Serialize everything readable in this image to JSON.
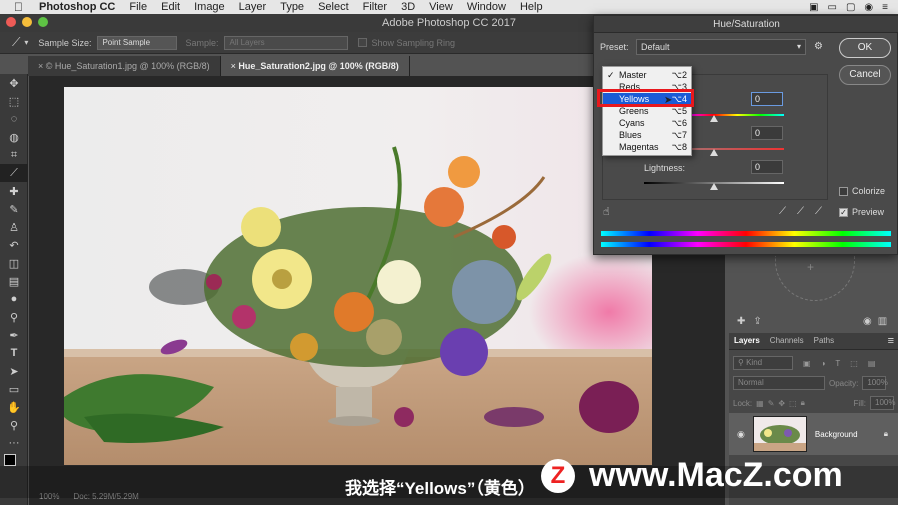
{
  "menubar": {
    "apple": "",
    "app_name": "Photoshop CC",
    "items": [
      "File",
      "Edit",
      "Image",
      "Layer",
      "Type",
      "Select",
      "Filter",
      "3D",
      "View",
      "Window",
      "Help"
    ]
  },
  "window": {
    "title": "Adobe Photoshop CC 2017"
  },
  "options_bar": {
    "sample_size_label": "Sample Size:",
    "sample_size_value": "Point Sample",
    "sample_label": "Sample:",
    "sample_value": "All Layers",
    "show_ring_label": "Show Sampling Ring"
  },
  "tabs": [
    {
      "label": "© Hue_Saturation1.jpg @ 100% (RGB/8)",
      "active": false
    },
    {
      "label": "Hue_Saturation2.jpg @ 100% (RGB/8)",
      "active": true
    }
  ],
  "status": {
    "zoom": "100%",
    "doc": "Doc: 5.29M/5.29M"
  },
  "dialog": {
    "title": "Hue/Saturation",
    "preset_label": "Preset:",
    "preset_value": "Default",
    "ok_label": "OK",
    "cancel_label": "Cancel",
    "hue_value": "0",
    "saturation_value": "0",
    "lightness_label": "Lightness:",
    "lightness_value": "0",
    "colorize_label": "Colorize",
    "preview_label": "Preview",
    "preview_checked": true,
    "colorize_checked": false
  },
  "channel_dropdown": {
    "items": [
      {
        "label": "Master",
        "key": "⌥2",
        "checked": true
      },
      {
        "label": "Reds",
        "key": "⌥3",
        "checked": false
      },
      {
        "label": "Yellows",
        "key": "⌥4",
        "checked": false,
        "highlight": true
      },
      {
        "label": "Greens",
        "key": "⌥5",
        "checked": false
      },
      {
        "label": "Cyans",
        "key": "⌥6",
        "checked": false
      },
      {
        "label": "Blues",
        "key": "⌥7",
        "checked": false
      },
      {
        "label": "Magentas",
        "key": "⌥8",
        "checked": false
      }
    ]
  },
  "layers_panel": {
    "tabs": [
      "Layers",
      "Channels",
      "Paths"
    ],
    "kind_label": "Kind",
    "blend_mode": "Normal",
    "opacity_label": "Opacity:",
    "opacity_value": "100%",
    "lock_label": "Lock:",
    "fill_label": "Fill:",
    "fill_value": "100%",
    "layer_name": "Background"
  },
  "subtitle": {
    "text": "我选择“Yellows”（黄色）"
  },
  "watermark": {
    "logo": "Z",
    "text": "www.MacZ.com"
  },
  "colors": {
    "highlight_box": "#e8181d",
    "menu_selection": "#1a5bd6"
  }
}
